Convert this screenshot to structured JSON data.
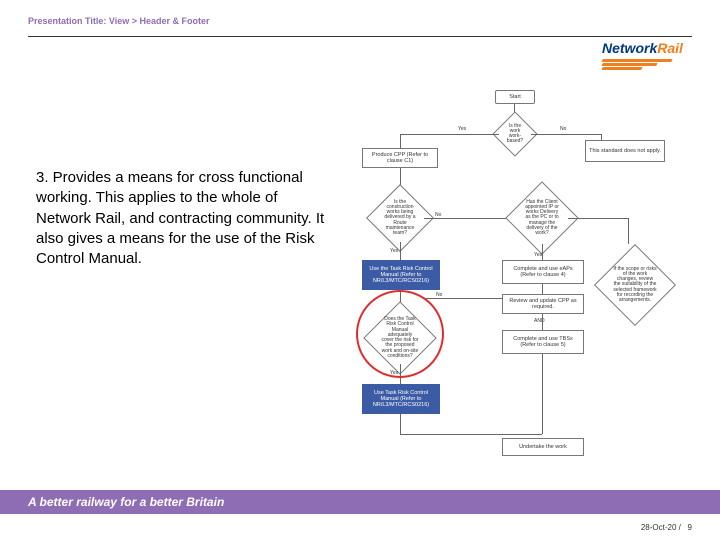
{
  "header": {
    "title": "Presentation Title: View > Header & Footer",
    "logo": {
      "word1": "Network",
      "word2": "Rail"
    }
  },
  "body": {
    "text": "3. Provides a means for cross functional working.  This applies to the whole of Network Rail, and contracting community. It also gives a means for the use of the Risk Control Manual."
  },
  "flow": {
    "start": "Start",
    "d1": "Is the work work-based?",
    "yes": "Yes",
    "no": "No",
    "b_right1": "This standard does not apply.",
    "b_left1": "Produce CPP (Refer to clause C1)",
    "d_left2": "Is the construction works being delivered by a Route maintenance team?",
    "d_right2": "Has the Client appointed IP or works Delivery as the PC or to manage the delivery of the work?",
    "b_blue1": "Use the Task Risk Control Manual (Refer to NR/L3/MTC/RCS0216)",
    "b_mid_right": "Complete and use eAPs (Refer to clause 4)",
    "b_mid_right2": "Review and update CPP as required.",
    "and": "AND",
    "b_mid_right3": "Complete and use TBSs (Refer to clause 5)",
    "d_scope": "If the scope or risks of the work changes, review the suitability of the selected framework for recording the arrangements.",
    "d_center": "Does the Task Risk Control Manual adequately cover the risk for the proposed work and on-site conditions?",
    "b_blue2": "Use Task Risk Control Manual (Refer to NR/L3/MTC/RCS0216)",
    "b_end": "Undertake the work"
  },
  "footer": {
    "tagline": "A better railway for a better Britain",
    "date": "28-Oct-20",
    "sep": "/",
    "page": "9"
  }
}
